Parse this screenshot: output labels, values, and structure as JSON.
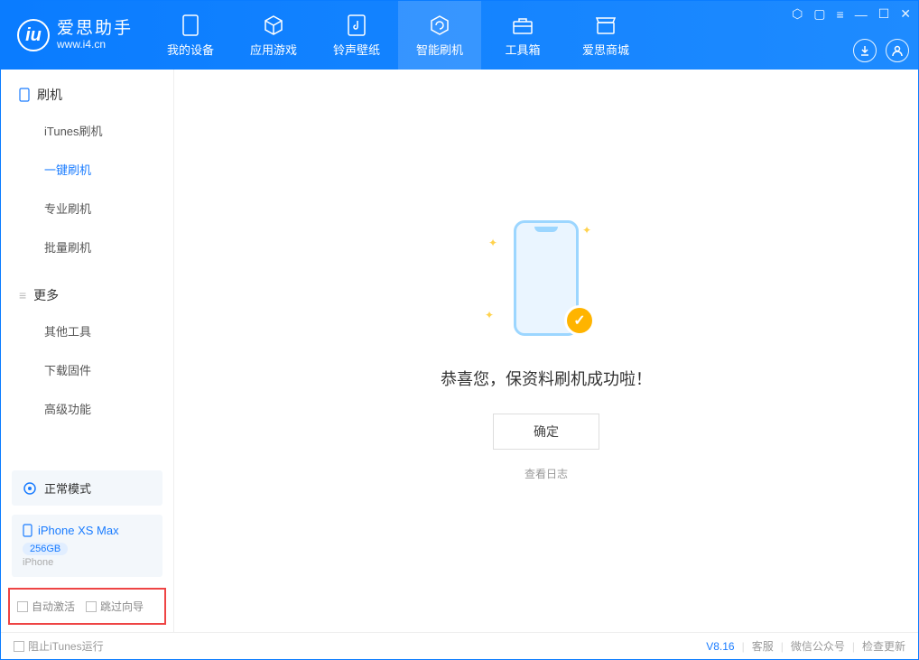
{
  "logo": {
    "title": "爱思助手",
    "url": "www.i4.cn"
  },
  "nav": {
    "items": [
      {
        "label": "我的设备"
      },
      {
        "label": "应用游戏"
      },
      {
        "label": "铃声壁纸"
      },
      {
        "label": "智能刷机"
      },
      {
        "label": "工具箱"
      },
      {
        "label": "爱思商城"
      }
    ]
  },
  "sidebar": {
    "section1": {
      "title": "刷机",
      "items": [
        {
          "label": "iTunes刷机"
        },
        {
          "label": "一键刷机"
        },
        {
          "label": "专业刷机"
        },
        {
          "label": "批量刷机"
        }
      ]
    },
    "section2": {
      "title": "更多",
      "items": [
        {
          "label": "其他工具"
        },
        {
          "label": "下载固件"
        },
        {
          "label": "高级功能"
        }
      ]
    },
    "mode": "正常模式",
    "device": {
      "name": "iPhone XS Max",
      "capacity": "256GB",
      "type": "iPhone"
    },
    "checkboxes": {
      "auto_activate": "自动激活",
      "skip_guide": "跳过向导"
    }
  },
  "main": {
    "message": "恭喜您，保资料刷机成功啦！",
    "ok": "确定",
    "view_log": "查看日志"
  },
  "footer": {
    "block_itunes": "阻止iTunes运行",
    "version": "V8.16",
    "support": "客服",
    "wechat": "微信公众号",
    "check_update": "检查更新"
  }
}
